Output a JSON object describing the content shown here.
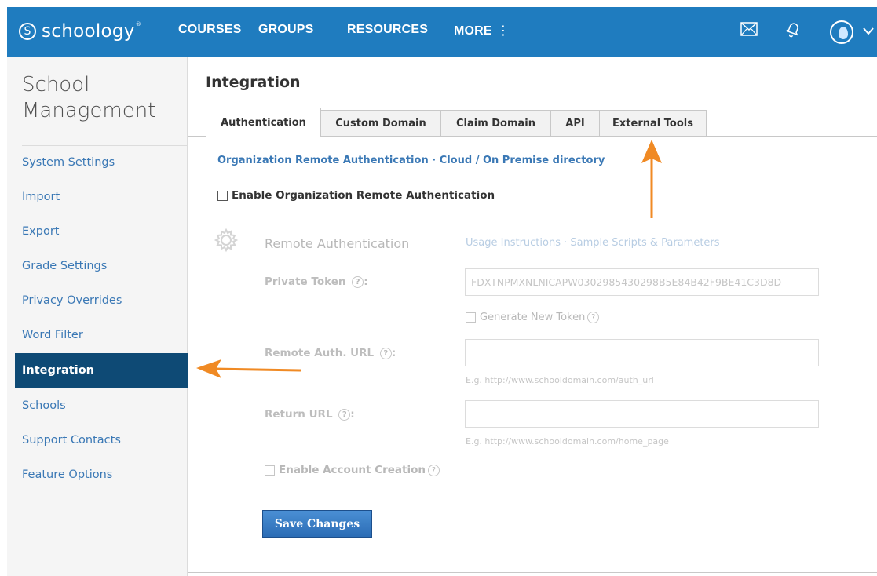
{
  "brand": {
    "logo_glyph": "S",
    "name": "schoology",
    "mark": "®",
    "color": "#1f7cbf"
  },
  "topnav": {
    "items": [
      "COURSES",
      "GROUPS",
      "RESOURCES",
      "MORE"
    ],
    "more_glyph": "⋮",
    "icons": [
      "mail-icon",
      "bell-icon",
      "avatar",
      "chevron-down-icon"
    ]
  },
  "sidebar": {
    "title_line1": "School",
    "title_line2": "Management",
    "items": [
      {
        "label": "System Settings"
      },
      {
        "label": "Import"
      },
      {
        "label": "Export"
      },
      {
        "label": "Grade Settings"
      },
      {
        "label": "Privacy Overrides"
      },
      {
        "label": "Word Filter"
      },
      {
        "label": "Integration",
        "active": true
      },
      {
        "label": "Schools"
      },
      {
        "label": "Support Contacts"
      },
      {
        "label": "Feature Options"
      }
    ],
    "active_color": "#0e4a75"
  },
  "main": {
    "title": "Integration",
    "tabs": [
      {
        "label": "Authentication",
        "active": true
      },
      {
        "label": "Custom Domain"
      },
      {
        "label": "Claim Domain"
      },
      {
        "label": "API"
      },
      {
        "label": "External Tools"
      }
    ],
    "sublink": "Organization Remote Authentication · Cloud / On Premise directory",
    "enable_label": "Enable Organization Remote Authentication",
    "remote_auth": {
      "title": "Remote Authentication",
      "links": "Usage Instructions · Sample Scripts & Parameters",
      "private_token_label": "Private Token",
      "private_token_value": "FDXTNPMXNLNICAPW0302985430298B5E84B42F9BE41C3D8D",
      "generate_label": "Generate New Token",
      "remote_url_label": "Remote Auth. URL",
      "remote_url_value": "",
      "remote_url_hint": "E.g. http://www.schooldomain.com/auth_url",
      "return_url_label": "Return URL",
      "return_url_value": "",
      "return_url_hint": "E.g. http://www.schooldomain.com/home_page",
      "account_creation_label": "Enable Account Creation",
      "help_glyph": "?"
    },
    "save_label": "Save Changes"
  },
  "annotation_color": "#f08a24"
}
